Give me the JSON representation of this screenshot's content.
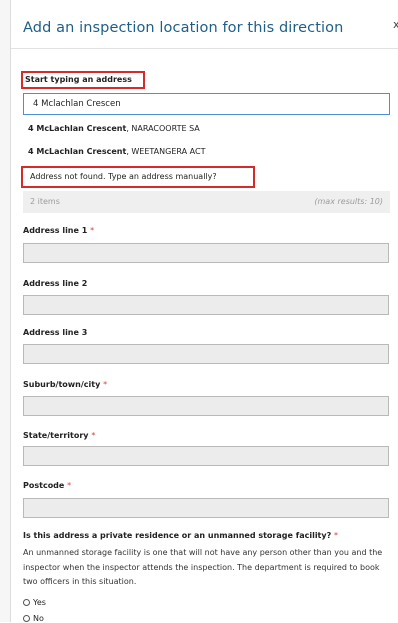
{
  "dialog": {
    "title": "Add an inspection location for this direction",
    "close": "x"
  },
  "search": {
    "label": "Start typing an address",
    "value": "4 Mclachlan Crescen",
    "suggestions": [
      {
        "bold": "4 McLachlan Crescent",
        "rest": ", NARACOORTE SA"
      },
      {
        "bold": "4 McLachlan Crescent",
        "rest": ", WEETANGERA ACT"
      }
    ],
    "not_found": "Address not found. Type an address manually?",
    "count": "2 items",
    "max": "(max results: 10)"
  },
  "fields": {
    "address1": "Address line 1",
    "address2": "Address line 2",
    "address3": "Address line 3",
    "suburb": "Suburb/town/city",
    "state": "State/territory",
    "postcode": "Postcode",
    "required_mark": "*"
  },
  "question": {
    "text": "Is this address a private residence or an unmanned storage facility?",
    "help": "An unmanned storage facility is one that will not have any person other than you and the inspector when the inspector attends the inspection. The department is required to book two officers in this situation.",
    "yes": "Yes",
    "no": "No"
  },
  "colors": {
    "title": "#1e5f86",
    "highlight": "#d52b2b",
    "required": "#d0433a",
    "focus": "#4a90d9"
  }
}
